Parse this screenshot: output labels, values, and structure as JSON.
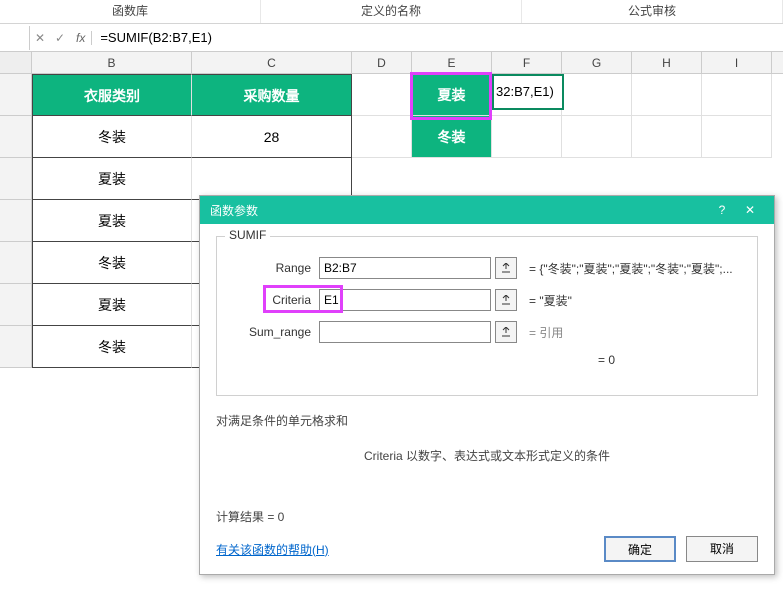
{
  "ribbon": {
    "groups": [
      "函数库",
      "定义的名称",
      "公式审核"
    ]
  },
  "formula_bar": {
    "cancel_glyph": "✕",
    "accept_glyph": "✓",
    "fx": "fx",
    "formula": "=SUMIF(B2:B7,E1)"
  },
  "columns": [
    "B",
    "C",
    "D",
    "E",
    "F",
    "G",
    "H",
    "I"
  ],
  "sheet": {
    "b_header": "衣服类别",
    "c_header": "采购数量",
    "b_rows": [
      "冬装",
      "夏装",
      "夏装",
      "冬装",
      "夏装",
      "冬装"
    ],
    "c2": "28",
    "e1": "夏装",
    "e2": "冬装",
    "f1_display": "32:B7,E1)"
  },
  "dialog": {
    "title": "函数参数",
    "help_glyph": "?",
    "close_glyph": "✕",
    "legend": "SUMIF",
    "args": {
      "range_label": "Range",
      "range_value": "B2:B7",
      "range_result": "=  {\"冬装\";\"夏装\";\"夏装\";\"冬装\";\"夏装\";...",
      "criteria_label": "Criteria",
      "criteria_value": "E1",
      "criteria_result": "=  \"夏装\"",
      "sumrange_label": "Sum_range",
      "sumrange_value": "",
      "sumrange_result": "=  引用",
      "final_result": "=  0"
    },
    "desc_line1": "对满足条件的单元格求和",
    "desc_line2": "Criteria  以数字、表达式或文本形式定义的条件",
    "calc_result": "计算结果 =  0",
    "help_link": "有关该函数的帮助(H)",
    "ok": "确定",
    "cancel": "取消"
  },
  "chart_data": {
    "type": "table",
    "title": "",
    "columns": [
      "衣服类别",
      "采购数量"
    ],
    "rows": [
      [
        "冬装",
        28
      ],
      [
        "夏装",
        null
      ],
      [
        "夏装",
        null
      ],
      [
        "冬装",
        null
      ],
      [
        "夏装",
        null
      ],
      [
        "冬装",
        null
      ]
    ]
  }
}
